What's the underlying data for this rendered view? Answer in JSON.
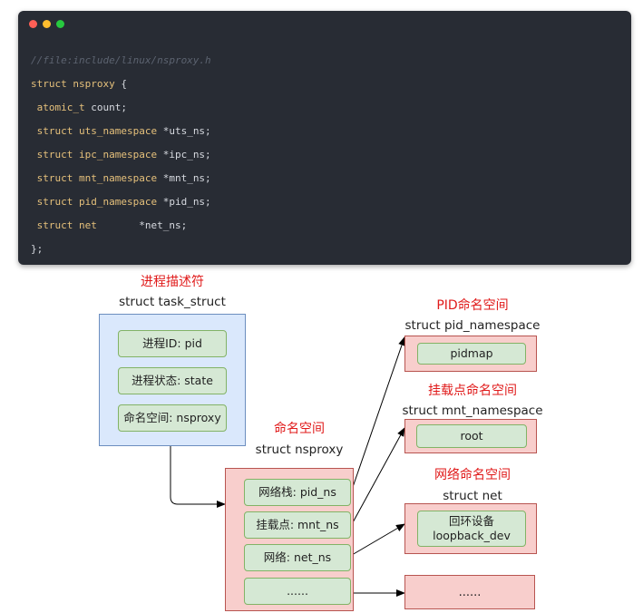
{
  "colors": {
    "code_bg": "#282c34",
    "dot_red": "#ff5f56",
    "dot_yellow": "#ffbd2e",
    "dot_green": "#27c93f",
    "blue_fill": "#dae8fc",
    "pink_fill": "#f8cecc",
    "green_fill": "#d5e8d4",
    "title_red": "#e01a1a"
  },
  "code": {
    "comment": "//file:include/linux/nsproxy.h",
    "struct_kw": "struct",
    "struct_name": "nsproxy",
    "open_brace": " {",
    "close_brace": "};",
    "fields": [
      {
        "type": " atomic_t",
        "name": " count;"
      },
      {
        "type": " struct uts_namespace",
        "name": " *uts_ns;"
      },
      {
        "type": " struct ipc_namespace",
        "name": " *ipc_ns;"
      },
      {
        "type": " struct mnt_namespace",
        "name": " *mnt_ns;"
      },
      {
        "type": " struct pid_namespace",
        "name": " *pid_ns;"
      },
      {
        "type": " struct net",
        "name": "       *net_ns;"
      }
    ]
  },
  "diagram": {
    "task": {
      "title": "进程描述符",
      "subtitle": "struct task_struct",
      "fields": [
        "进程ID: pid",
        "进程状态: state",
        "命名空间: nsproxy"
      ]
    },
    "nsproxy": {
      "title": "命名空间",
      "subtitle": "struct nsproxy",
      "fields": [
        "网络栈: pid_ns",
        "挂载点: mnt_ns",
        "网络: net_ns",
        "......"
      ]
    },
    "pid_ns": {
      "title": "PID命名空间",
      "subtitle": "struct pid_namespace",
      "field": "pidmap"
    },
    "mnt_ns": {
      "title": "挂载点命名空间",
      "subtitle": "struct mnt_namespace",
      "field": "root"
    },
    "net_ns": {
      "title": "网络命名空间",
      "subtitle": "struct net",
      "field_line1": "回环设备",
      "field_line2": "loopback_dev"
    },
    "other": {
      "field": "......"
    }
  }
}
